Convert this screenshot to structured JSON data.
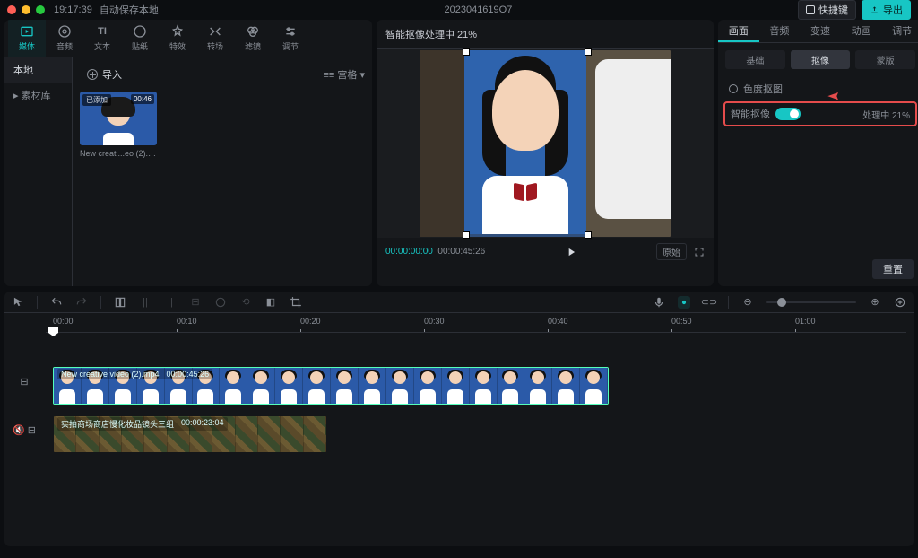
{
  "system": {
    "time": "19:17:39",
    "autosave": "自动保存本地",
    "project": "2023041619O7",
    "shortcut_btn": "快捷键",
    "export_btn": "导出"
  },
  "media": {
    "tabs": [
      {
        "id": "media",
        "label": "媒体"
      },
      {
        "id": "audio",
        "label": "音频"
      },
      {
        "id": "text",
        "label": "文本"
      },
      {
        "id": "sticker",
        "label": "贴纸"
      },
      {
        "id": "effect",
        "label": "特效"
      },
      {
        "id": "transition",
        "label": "转场"
      },
      {
        "id": "filter",
        "label": "滤镜"
      },
      {
        "id": "adjust",
        "label": "调节"
      }
    ],
    "nav": {
      "local": "本地",
      "library": "素材库"
    },
    "import": "导入",
    "sort": "排序 ",
    "sort_suffix": "宫格",
    "item": {
      "tag": "已添加",
      "duration": "00:46",
      "name": "New creati...eo (2).mp4"
    }
  },
  "preview": {
    "status": "智能抠像处理中 21%",
    "current": "00:00:00:00",
    "total": "00:00:45:26",
    "original_chip": "原始"
  },
  "inspector": {
    "tabs": [
      "画面",
      "音频",
      "变速",
      "动画",
      "调节"
    ],
    "sub_tabs": [
      "基础",
      "抠像",
      "蒙版"
    ],
    "chroma": "色度抠图",
    "smart": "智能抠像",
    "processing": "处理中 21%",
    "reset": "重置"
  },
  "timeline": {
    "ruler": [
      "00:00",
      "00:10",
      "00:20",
      "00:30",
      "00:40",
      "00:50",
      "01:00"
    ],
    "clip1": {
      "name": "New creative video (2).mp4",
      "dur": "00:00:45:26"
    },
    "clip2": {
      "name": "实拍商场商店慢化妆品镜头三组",
      "dur": "00:00:23:04"
    }
  }
}
